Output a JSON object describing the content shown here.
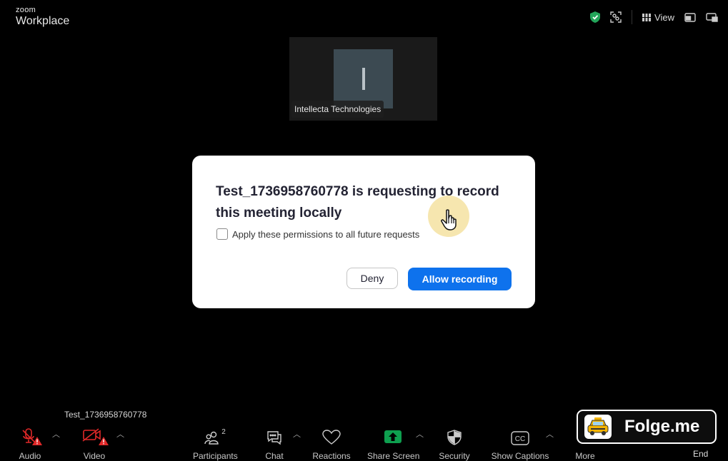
{
  "app": {
    "brand_small": "zoom",
    "brand_big": "Workplace"
  },
  "topbar": {
    "view_label": "View"
  },
  "video_tile": {
    "participant_name": "Intellecta Technologies"
  },
  "dialog": {
    "title": "Test_1736958760778 is requesting to record this meeting locally",
    "checkbox_label": "Apply these permissions to all future requests",
    "deny_label": "Deny",
    "allow_label": "Allow recording"
  },
  "self_name": "Test_1736958760778",
  "toolbar": {
    "audio": "Audio",
    "video": "Video",
    "participants": "Participants",
    "participants_count": "2",
    "chat": "Chat",
    "reactions": "Reactions",
    "share_screen": "Share Screen",
    "security": "Security",
    "show_captions": "Show Captions",
    "more": "More",
    "end": "End"
  },
  "watermark": {
    "label": "Folge.me"
  },
  "colors": {
    "accent": "#0e72ed",
    "share_green": "#0e9f4f",
    "alert_red": "#e02828",
    "shield_green": "#23a55a"
  }
}
